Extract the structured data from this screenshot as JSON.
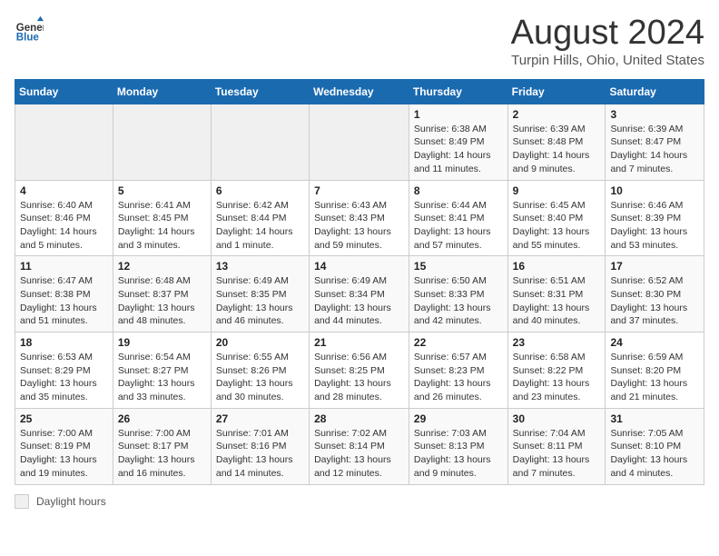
{
  "header": {
    "logo_general": "General",
    "logo_blue": "Blue",
    "title": "August 2024",
    "subtitle": "Turpin Hills, Ohio, United States"
  },
  "days_of_week": [
    "Sunday",
    "Monday",
    "Tuesday",
    "Wednesday",
    "Thursday",
    "Friday",
    "Saturday"
  ],
  "weeks": [
    [
      {
        "day": "",
        "info": ""
      },
      {
        "day": "",
        "info": ""
      },
      {
        "day": "",
        "info": ""
      },
      {
        "day": "",
        "info": ""
      },
      {
        "day": "1",
        "info": "Sunrise: 6:38 AM\nSunset: 8:49 PM\nDaylight: 14 hours and 11 minutes."
      },
      {
        "day": "2",
        "info": "Sunrise: 6:39 AM\nSunset: 8:48 PM\nDaylight: 14 hours and 9 minutes."
      },
      {
        "day": "3",
        "info": "Sunrise: 6:39 AM\nSunset: 8:47 PM\nDaylight: 14 hours and 7 minutes."
      }
    ],
    [
      {
        "day": "4",
        "info": "Sunrise: 6:40 AM\nSunset: 8:46 PM\nDaylight: 14 hours and 5 minutes."
      },
      {
        "day": "5",
        "info": "Sunrise: 6:41 AM\nSunset: 8:45 PM\nDaylight: 14 hours and 3 minutes."
      },
      {
        "day": "6",
        "info": "Sunrise: 6:42 AM\nSunset: 8:44 PM\nDaylight: 14 hours and 1 minute."
      },
      {
        "day": "7",
        "info": "Sunrise: 6:43 AM\nSunset: 8:43 PM\nDaylight: 13 hours and 59 minutes."
      },
      {
        "day": "8",
        "info": "Sunrise: 6:44 AM\nSunset: 8:41 PM\nDaylight: 13 hours and 57 minutes."
      },
      {
        "day": "9",
        "info": "Sunrise: 6:45 AM\nSunset: 8:40 PM\nDaylight: 13 hours and 55 minutes."
      },
      {
        "day": "10",
        "info": "Sunrise: 6:46 AM\nSunset: 8:39 PM\nDaylight: 13 hours and 53 minutes."
      }
    ],
    [
      {
        "day": "11",
        "info": "Sunrise: 6:47 AM\nSunset: 8:38 PM\nDaylight: 13 hours and 51 minutes."
      },
      {
        "day": "12",
        "info": "Sunrise: 6:48 AM\nSunset: 8:37 PM\nDaylight: 13 hours and 48 minutes."
      },
      {
        "day": "13",
        "info": "Sunrise: 6:49 AM\nSunset: 8:35 PM\nDaylight: 13 hours and 46 minutes."
      },
      {
        "day": "14",
        "info": "Sunrise: 6:49 AM\nSunset: 8:34 PM\nDaylight: 13 hours and 44 minutes."
      },
      {
        "day": "15",
        "info": "Sunrise: 6:50 AM\nSunset: 8:33 PM\nDaylight: 13 hours and 42 minutes."
      },
      {
        "day": "16",
        "info": "Sunrise: 6:51 AM\nSunset: 8:31 PM\nDaylight: 13 hours and 40 minutes."
      },
      {
        "day": "17",
        "info": "Sunrise: 6:52 AM\nSunset: 8:30 PM\nDaylight: 13 hours and 37 minutes."
      }
    ],
    [
      {
        "day": "18",
        "info": "Sunrise: 6:53 AM\nSunset: 8:29 PM\nDaylight: 13 hours and 35 minutes."
      },
      {
        "day": "19",
        "info": "Sunrise: 6:54 AM\nSunset: 8:27 PM\nDaylight: 13 hours and 33 minutes."
      },
      {
        "day": "20",
        "info": "Sunrise: 6:55 AM\nSunset: 8:26 PM\nDaylight: 13 hours and 30 minutes."
      },
      {
        "day": "21",
        "info": "Sunrise: 6:56 AM\nSunset: 8:25 PM\nDaylight: 13 hours and 28 minutes."
      },
      {
        "day": "22",
        "info": "Sunrise: 6:57 AM\nSunset: 8:23 PM\nDaylight: 13 hours and 26 minutes."
      },
      {
        "day": "23",
        "info": "Sunrise: 6:58 AM\nSunset: 8:22 PM\nDaylight: 13 hours and 23 minutes."
      },
      {
        "day": "24",
        "info": "Sunrise: 6:59 AM\nSunset: 8:20 PM\nDaylight: 13 hours and 21 minutes."
      }
    ],
    [
      {
        "day": "25",
        "info": "Sunrise: 7:00 AM\nSunset: 8:19 PM\nDaylight: 13 hours and 19 minutes."
      },
      {
        "day": "26",
        "info": "Sunrise: 7:00 AM\nSunset: 8:17 PM\nDaylight: 13 hours and 16 minutes."
      },
      {
        "day": "27",
        "info": "Sunrise: 7:01 AM\nSunset: 8:16 PM\nDaylight: 13 hours and 14 minutes."
      },
      {
        "day": "28",
        "info": "Sunrise: 7:02 AM\nSunset: 8:14 PM\nDaylight: 13 hours and 12 minutes."
      },
      {
        "day": "29",
        "info": "Sunrise: 7:03 AM\nSunset: 8:13 PM\nDaylight: 13 hours and 9 minutes."
      },
      {
        "day": "30",
        "info": "Sunrise: 7:04 AM\nSunset: 8:11 PM\nDaylight: 13 hours and 7 minutes."
      },
      {
        "day": "31",
        "info": "Sunrise: 7:05 AM\nSunset: 8:10 PM\nDaylight: 13 hours and 4 minutes."
      }
    ]
  ],
  "footer": {
    "legend_label": "Daylight hours"
  }
}
